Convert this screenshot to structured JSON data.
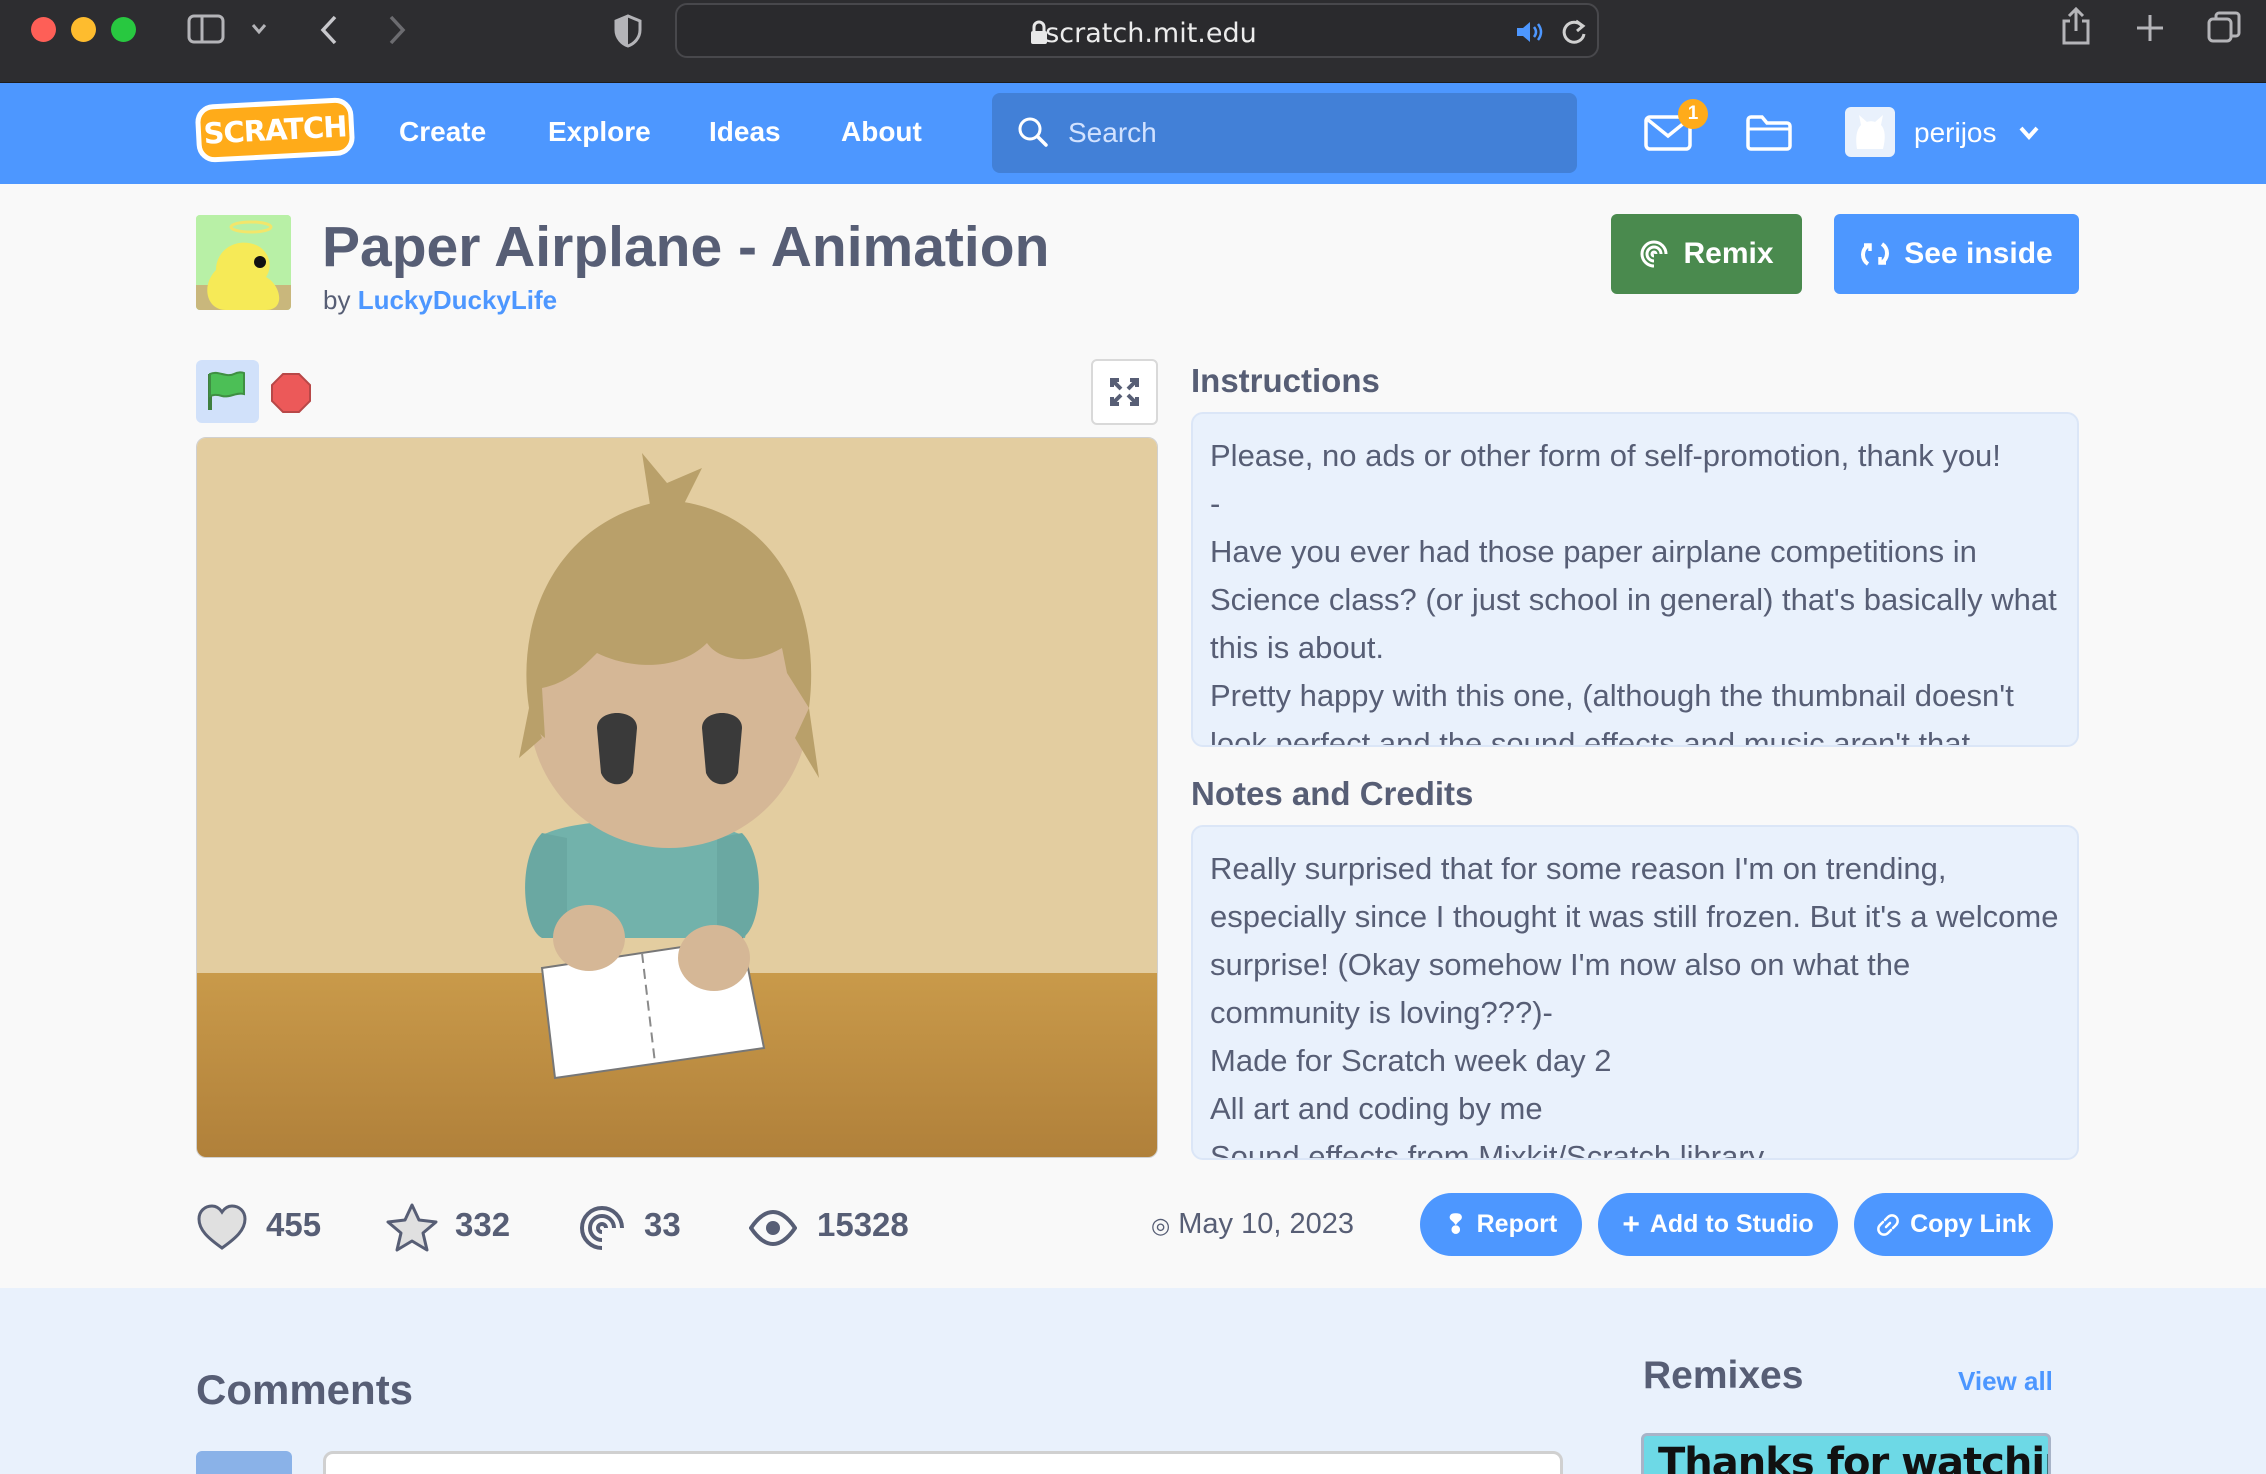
{
  "browser": {
    "url": "scratch.mit.edu"
  },
  "nav": {
    "logo": "SCRATCH",
    "links": [
      "Create",
      "Explore",
      "Ideas",
      "About"
    ],
    "search_placeholder": "Search",
    "messages_count": "1",
    "username": "perijos"
  },
  "project": {
    "title": "Paper Airplane - Animation",
    "by_prefix": "by",
    "author": "LuckyDuckyLife",
    "remix_label": "Remix",
    "see_inside_label": "See inside"
  },
  "instructions": {
    "label": "Instructions",
    "lines": [
      "Please, no ads or other form of self-promotion, thank you!",
      "-",
      "Have you ever had those paper airplane competitions in Science class? (or just school in general) that's basically what this is about.",
      "Pretty happy with this one, (although the thumbnail doesn't look perfect and the sound effects and music aren't that"
    ]
  },
  "notes": {
    "label": "Notes and Credits",
    "lines": [
      "Really surprised that for some reason I'm on trending, especially since I thought it was still frozen. But it's a welcome surprise! (Okay somehow I'm now also on what the community is loving???)-",
      "Made for Scratch week day 2",
      "All art and coding by me",
      "Sound effects from Mixkit/Scratch library"
    ]
  },
  "stats": {
    "loves": "455",
    "favorites": "332",
    "remixes": "33",
    "views": "15328",
    "date": "May 10, 2023"
  },
  "actions": {
    "report": "Report",
    "add_to_studio": "Add to Studio",
    "copy_link": "Copy Link"
  },
  "lower": {
    "comments_heading": "Comments",
    "remixes_heading": "Remixes",
    "view_all": "View all",
    "remix_thumb_text": "Thanks for watching!"
  },
  "colors": {
    "scratch_blue": "#4d97ff",
    "remix_green": "#4a8a4e",
    "text": "#575e75",
    "panel_bg": "#e9f1fc"
  }
}
